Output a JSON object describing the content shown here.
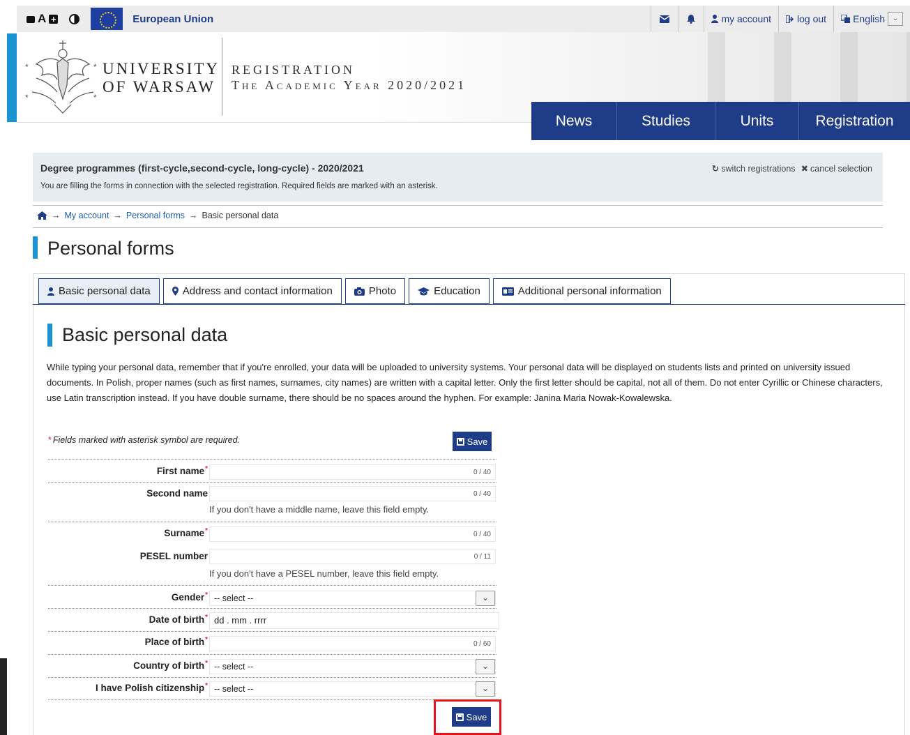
{
  "topbar": {
    "a_label": "A",
    "eu_label": "European Union",
    "mail_icon": "mail-icon",
    "bell_icon": "bell-icon",
    "my_account": "my account",
    "log_out": "log out",
    "language": "English"
  },
  "header": {
    "uni_line1": "UNIVERSITY",
    "uni_line2": "OF WARSAW",
    "reg_title": "REGISTRATION",
    "reg_year": "The Academic Year 2020/2021"
  },
  "nav": [
    "News",
    "Studies",
    "Units",
    "Registration"
  ],
  "reginfo": {
    "title": "Degree programmes (first-cycle,second-cycle, long-cycle) - 2020/2021",
    "desc": "You are filling the forms in connection with the selected registration. Required fields are marked with an asterisk.",
    "switch": "switch registrations",
    "cancel": "cancel selection"
  },
  "breadcrumb": {
    "arrow": "→",
    "my_account": "My account",
    "personal_forms": "Personal forms",
    "current": "Basic personal data"
  },
  "page_title": "Personal forms",
  "tabs": [
    {
      "label": "Basic personal data",
      "icon": "user-icon"
    },
    {
      "label": "Address and contact information",
      "icon": "map-marker-icon"
    },
    {
      "label": "Photo",
      "icon": "camera-icon"
    },
    {
      "label": "Education",
      "icon": "graduation-cap-icon"
    },
    {
      "label": "Additional personal information",
      "icon": "id-card-icon"
    }
  ],
  "section_title": "Basic personal data",
  "intro": "While typing your personal data, remember that if you're enrolled, your data will be uploaded to university systems. Your personal data will be displayed on students lists and printed on university issued documents. In Polish, proper names (such as first names, surnames, city names) are written with a capital letter. Only the first letter should be capital, not all of them. Do not enter Cyrillic or Chinese characters, use Latin transcription instead. If you have double surname, there should be no spaces around the hyphen. For example: Janina Maria Nowak-Kowalewska.",
  "required_note": "Fields marked with asterisk symbol are required.",
  "star": "*",
  "save_label": "Save",
  "form": {
    "first_name": {
      "label": "First name",
      "counter": "0 / 40"
    },
    "second_name": {
      "label": "Second name",
      "counter": "0 / 40",
      "hint": "If you don't have a middle name, leave this field empty."
    },
    "surname": {
      "label": "Surname",
      "counter": "0 / 40"
    },
    "pesel": {
      "label": "PESEL number",
      "counter": "0 / 11",
      "hint": "If you don't have a PESEL number, leave this field empty."
    },
    "gender": {
      "label": "Gender",
      "value": "-- select --"
    },
    "date_of_birth": {
      "label": "Date of birth",
      "placeholder": "dd . mm . rrrr"
    },
    "place_of_birth": {
      "label": "Place of birth",
      "counter": "0 / 60"
    },
    "country_of_birth": {
      "label": "Country of birth",
      "value": "-- select --"
    },
    "polish_citizenship": {
      "label": "I have Polish citizenship",
      "value": "-- select --"
    }
  },
  "colors": {
    "brand": "#1f3c88",
    "accent": "#1a93d0",
    "required": "#d9283b",
    "highlight": "#e3121b"
  }
}
